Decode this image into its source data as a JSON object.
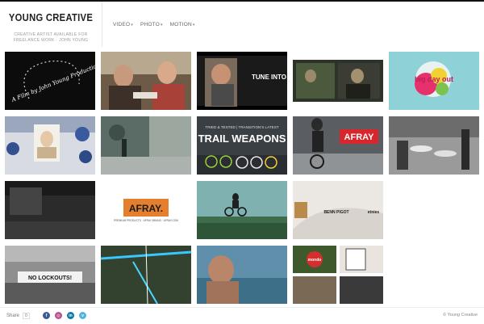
{
  "brand": {
    "title": "YOUNG CREATIVE",
    "subtitle": "CREATIVE ARTIST AVAILABLE FOR FREELANCE WORK - JOHN YOUNG"
  },
  "nav": [
    {
      "label": "VIDEO"
    },
    {
      "label": "PHOTO"
    },
    {
      "label": "MOTION"
    }
  ],
  "thumbnails": [
    {
      "caption": "A Film by John Young Production"
    },
    {
      "caption": ""
    },
    {
      "caption": "TUNE INTO ART"
    },
    {
      "caption": ""
    },
    {
      "caption": "big day out"
    },
    {
      "caption": ""
    },
    {
      "caption": ""
    },
    {
      "caption": "TRAIL WEAPONS",
      "top": "TRIED & TESTED | TRANSITION'S LATEST"
    },
    {
      "caption": "AFRAY"
    },
    {
      "caption": ""
    },
    {
      "caption": ""
    },
    {
      "caption": "AFRAY.",
      "sub": "PREMIUM PRODUCTS · AFRAY BRAND · AFRAY.COM"
    },
    {
      "caption": ""
    },
    {
      "caption": "BENN PIGOT",
      "logo": "etnies"
    },
    {
      "caption": "NO LOCKOUTS!"
    },
    {
      "caption": ""
    },
    {
      "caption": ""
    },
    {
      "caption": "mondo"
    }
  ],
  "footer": {
    "share_label": "Share",
    "share_count": "0",
    "social": [
      {
        "icon": "facebook-icon",
        "glyph": "f",
        "color": "#3b5998"
      },
      {
        "icon": "instagram-icon",
        "glyph": "◎",
        "color": "#b5508c"
      },
      {
        "icon": "linkedin-icon",
        "glyph": "in",
        "color": "#0e76a8"
      },
      {
        "icon": "vimeo-icon",
        "glyph": "v",
        "color": "#53b3e0"
      }
    ],
    "copyright": "© Young Creative"
  }
}
